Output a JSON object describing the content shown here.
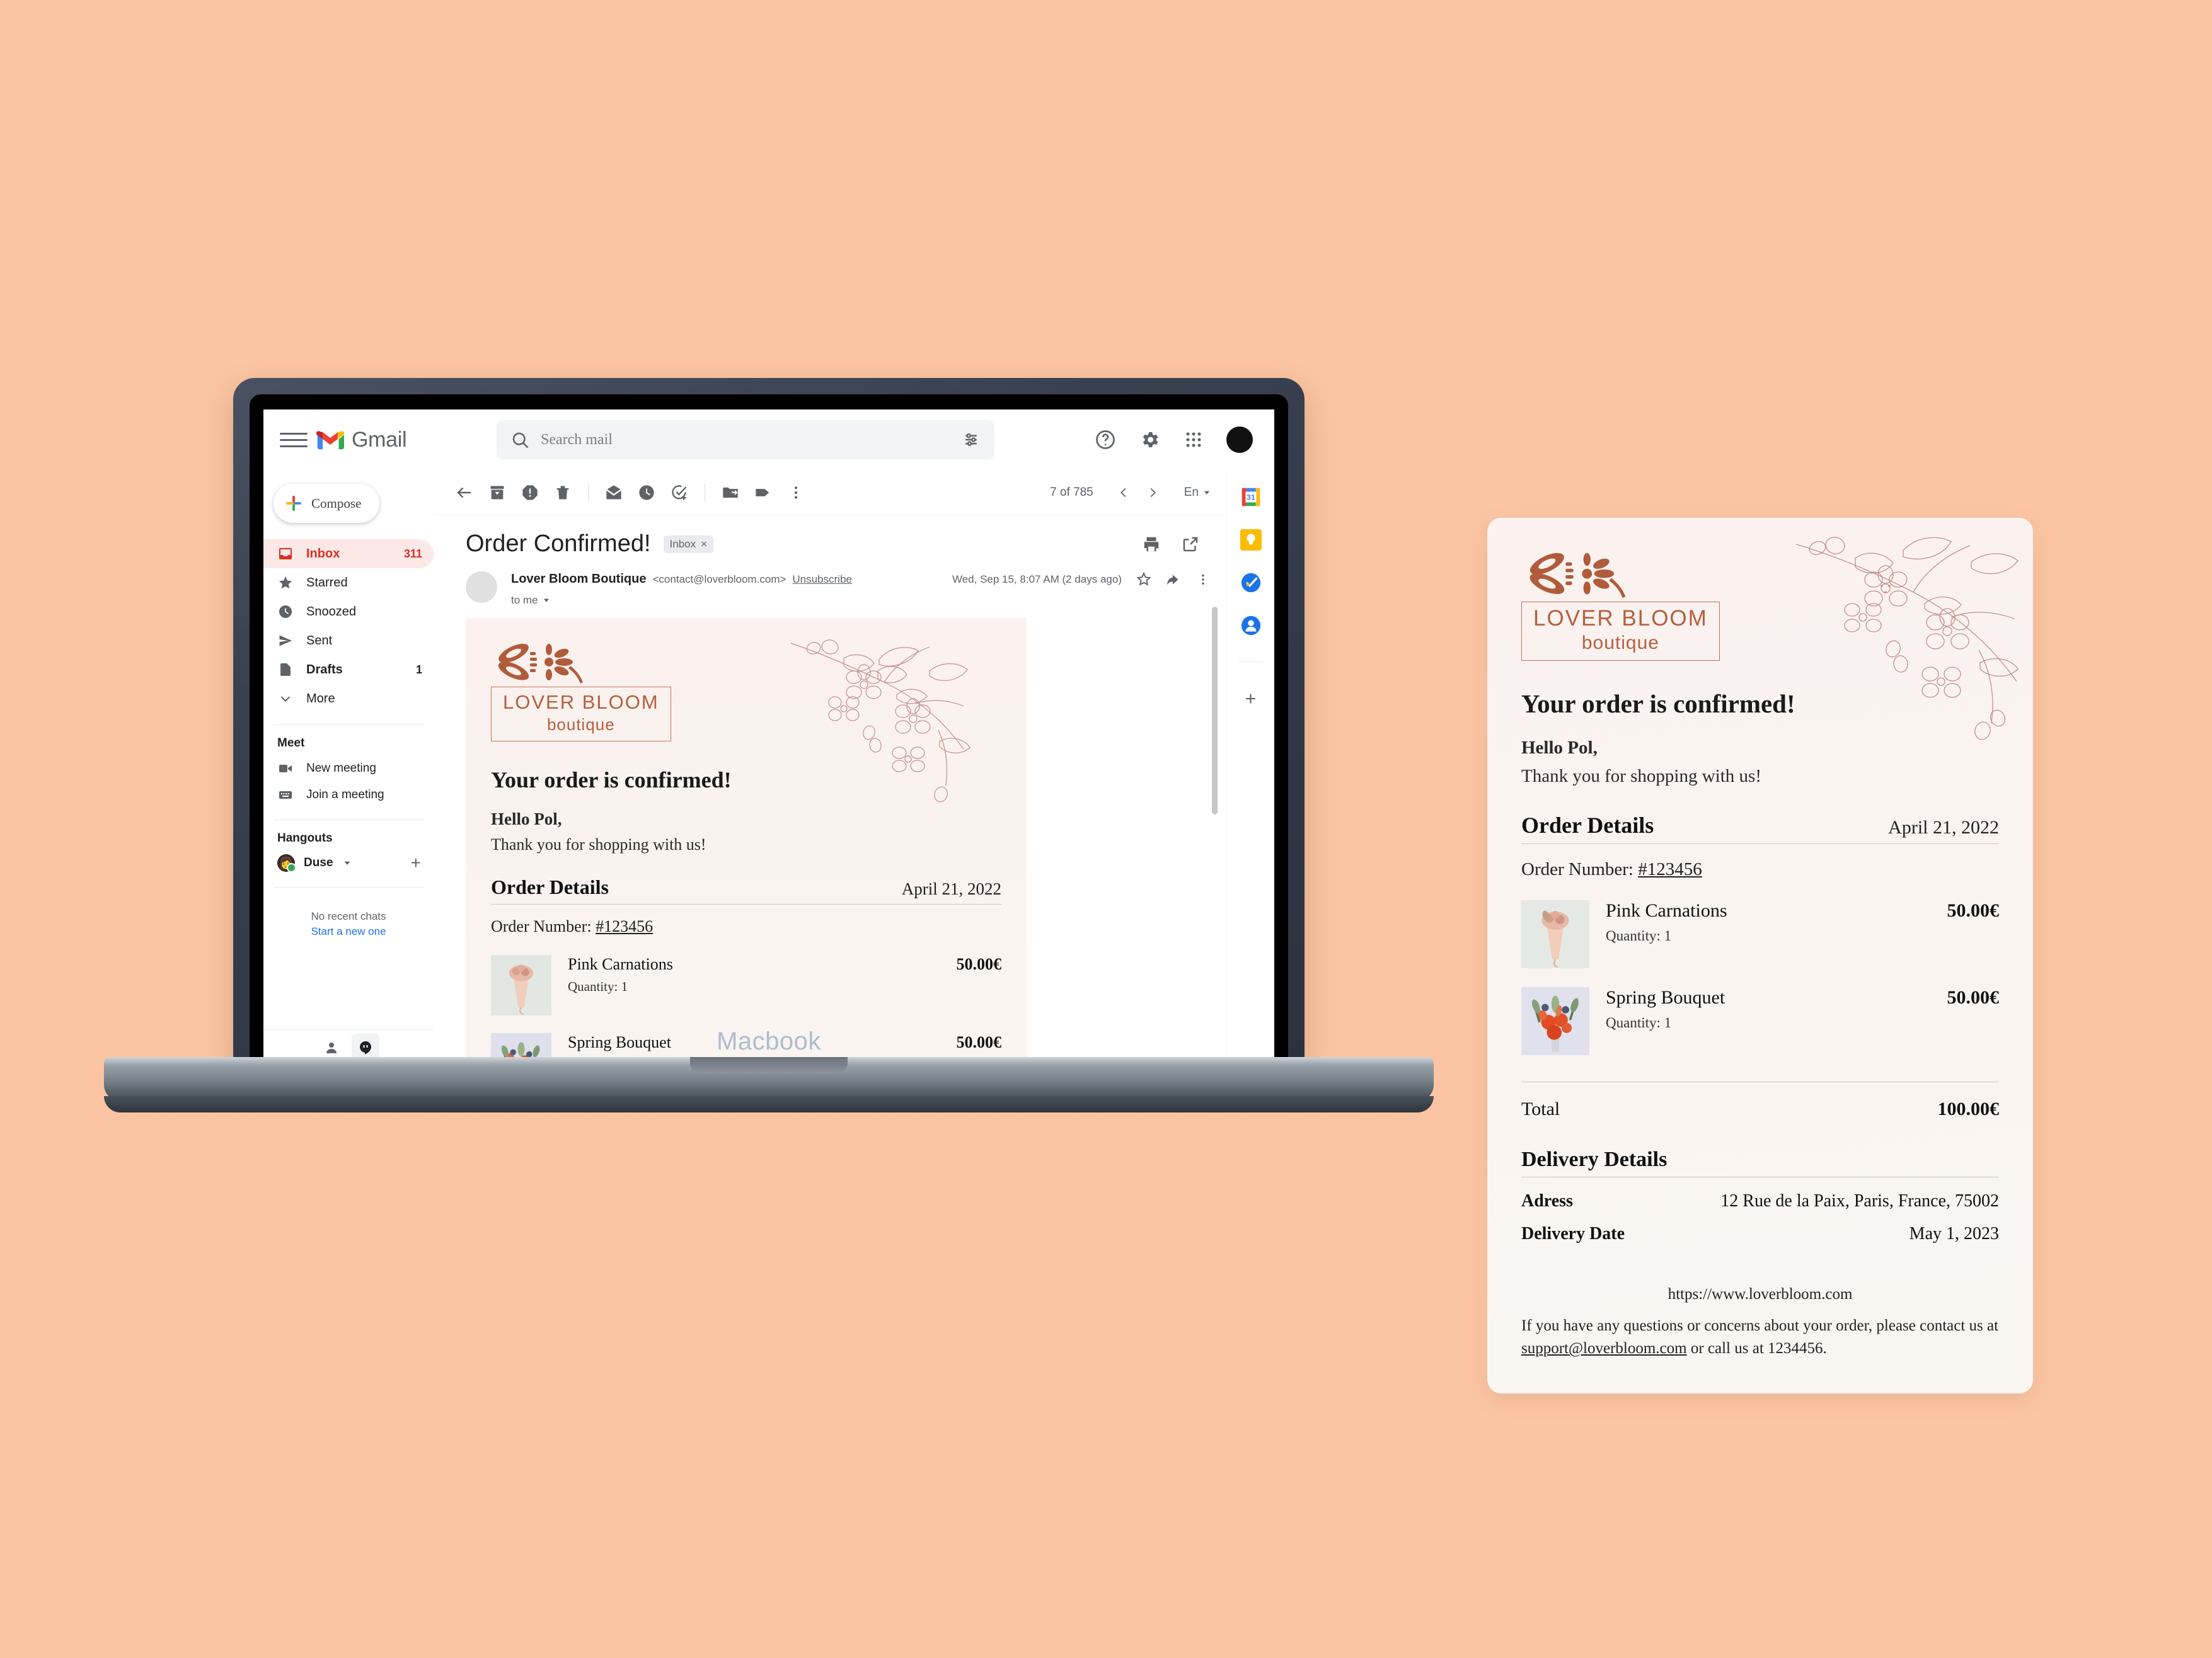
{
  "gmail": {
    "brand": "Gmail",
    "search": {
      "placeholder": "Search mail",
      "value": ""
    },
    "compose_label": "Compose",
    "nav": [
      {
        "label": "Inbox",
        "count": "311",
        "icon": "inbox-icon"
      },
      {
        "label": "Starred",
        "count": "",
        "icon": "star-icon"
      },
      {
        "label": "Snoozed",
        "count": "",
        "icon": "clock-icon"
      },
      {
        "label": "Sent",
        "count": "",
        "icon": "send-icon"
      },
      {
        "label": "Drafts",
        "count": "1",
        "icon": "draft-icon"
      },
      {
        "label": "More",
        "count": "",
        "icon": "chevron-down-icon"
      }
    ],
    "meet": {
      "title": "Meet",
      "new_meeting": "New meeting",
      "join_meeting": "Join a meeting"
    },
    "hangouts": {
      "title": "Hangouts",
      "user": "Duse",
      "no_recent": "No recent chats",
      "start_new": "Start a new one"
    },
    "pager": {
      "count": "7 of 785",
      "lang": "En"
    },
    "thread": {
      "subject": "Order Confirmed!",
      "label": "Inbox",
      "label_close": "×",
      "sender_name": "Lover Bloom Boutique",
      "sender_email": "<contact@loverbloom.com>",
      "unsubscribe": "Unsubscribe",
      "to": "to me",
      "date": "Wed, Sep 15, 8:07 AM (2 days ago)"
    }
  },
  "laptop": {
    "label": "Macbook"
  },
  "email": {
    "brand": {
      "name": "LOVER BLOOM",
      "sub": "boutique"
    },
    "heading": "Your order is confirmed!",
    "greeting": "Hello Pol,",
    "thanks": "Thank you for shopping with us!",
    "order_details_title": "Order Details",
    "order_date": "April 21, 2022",
    "order_number_label": "Order Number:",
    "order_number": "#123456",
    "items": [
      {
        "name": "Pink Carnations",
        "qty": "Quantity: 1",
        "price": "50.00€"
      },
      {
        "name": "Spring Bouquet",
        "qty": "Quantity: 1",
        "price": "50.00€"
      }
    ],
    "total_label": "Total",
    "total_value": "100.00€",
    "delivery_title": "Delivery Details",
    "address_label": "Adress",
    "address_value": "12 Rue de la Paix, Paris, France, 75002",
    "delivery_date_label": "Delivery Date",
    "delivery_date_value": "May 1, 2023",
    "site_url": "https://www.loverbloom.com",
    "footer_pre": "If you have any questions or concerns about your order, please contact us at ",
    "footer_email": "support@loverbloom.com",
    "footer_post": " or call us at 1234456."
  },
  "colors": {
    "background": "#fbc5a3",
    "card": "#faf4f0",
    "brand_terracotta": "#b55f3d",
    "floral_line": "#c08a8a",
    "gmail_red": "#d93025",
    "link_blue": "#1a73e8"
  }
}
